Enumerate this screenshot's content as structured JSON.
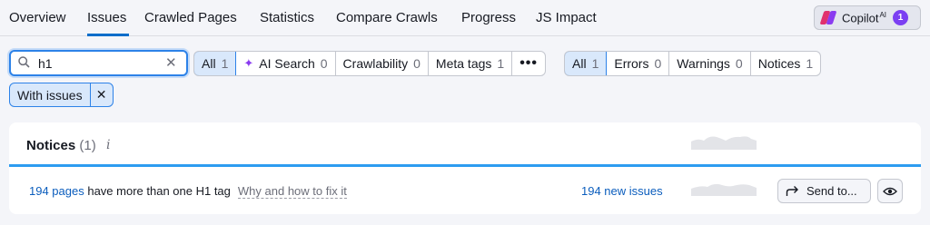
{
  "nav": {
    "tabs": [
      {
        "label": "Overview"
      },
      {
        "label": "Issues",
        "active": true
      },
      {
        "label": "Crawled Pages"
      },
      {
        "label": "Statistics"
      },
      {
        "label": "Compare Crawls"
      },
      {
        "label": "Progress"
      },
      {
        "label": "JS Impact"
      }
    ],
    "copilot": {
      "label": "Copilot",
      "sup": "AI",
      "badge": "1"
    }
  },
  "search": {
    "value": "h1",
    "clear_icon": "close-icon"
  },
  "categories": [
    {
      "label": "All",
      "count": "1",
      "selected": true
    },
    {
      "label": "AI Search",
      "count": "0",
      "icon": "sparkle-icon"
    },
    {
      "label": "Crawlability",
      "count": "0"
    },
    {
      "label": "Meta tags",
      "count": "1"
    },
    {
      "label": "•••"
    }
  ],
  "severity": [
    {
      "label": "All",
      "count": "1",
      "selected": true
    },
    {
      "label": "Errors",
      "count": "0"
    },
    {
      "label": "Warnings",
      "count": "0"
    },
    {
      "label": "Notices",
      "count": "1"
    }
  ],
  "active_filter": {
    "label": "With issues",
    "remove": "✕"
  },
  "card": {
    "title": "Notices",
    "count": "(1)",
    "info": "i",
    "issue": {
      "pages_link": "194 pages",
      "text": " have more than one H1 tag",
      "howto": "Why and how to fix it",
      "new_issues": "194 new issues",
      "send_label": "Send to..."
    }
  },
  "colors": {
    "accent": "#006dca",
    "link": "#0b5dbd",
    "copilot": "#7b3ff2",
    "bar": "#2d9cf0"
  }
}
